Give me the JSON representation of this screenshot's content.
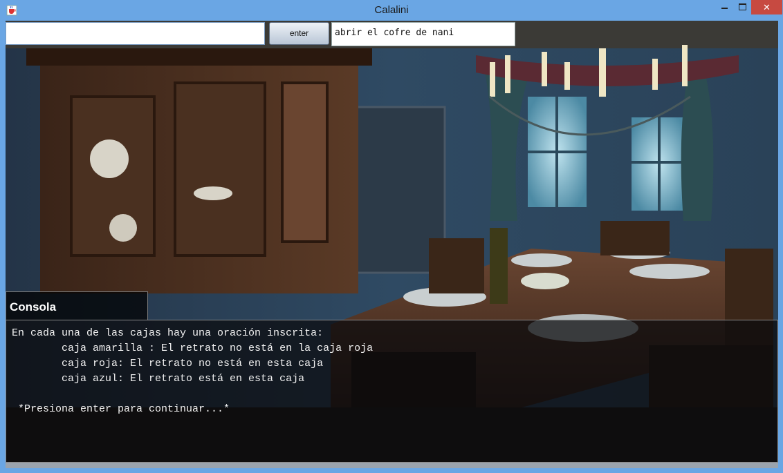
{
  "window": {
    "title": "Calalini",
    "minimize_label": "",
    "maximize_label": "",
    "close_label": "✕"
  },
  "controls": {
    "command_input_value": "",
    "enter_label": "enter",
    "last_command": "abrir el cofre de nani"
  },
  "console": {
    "label": "Consola",
    "text": "En cada una de las cajas hay una oración inscrita:\n        caja amarilla : El retrato no está en la caja roja\n        caja roja: El retrato no está en esta caja\n        caja azul: El retrato está en esta caja\n\n *Presiona enter para continuar...*"
  },
  "icons": {
    "app_icon": "java-cup-icon",
    "close_icon": "close-icon",
    "minimize_icon": "minimize-icon",
    "maximize_icon": "maximize-icon"
  },
  "colors": {
    "titlebar": "#6aa6e4",
    "close_button": "#c74a41"
  }
}
